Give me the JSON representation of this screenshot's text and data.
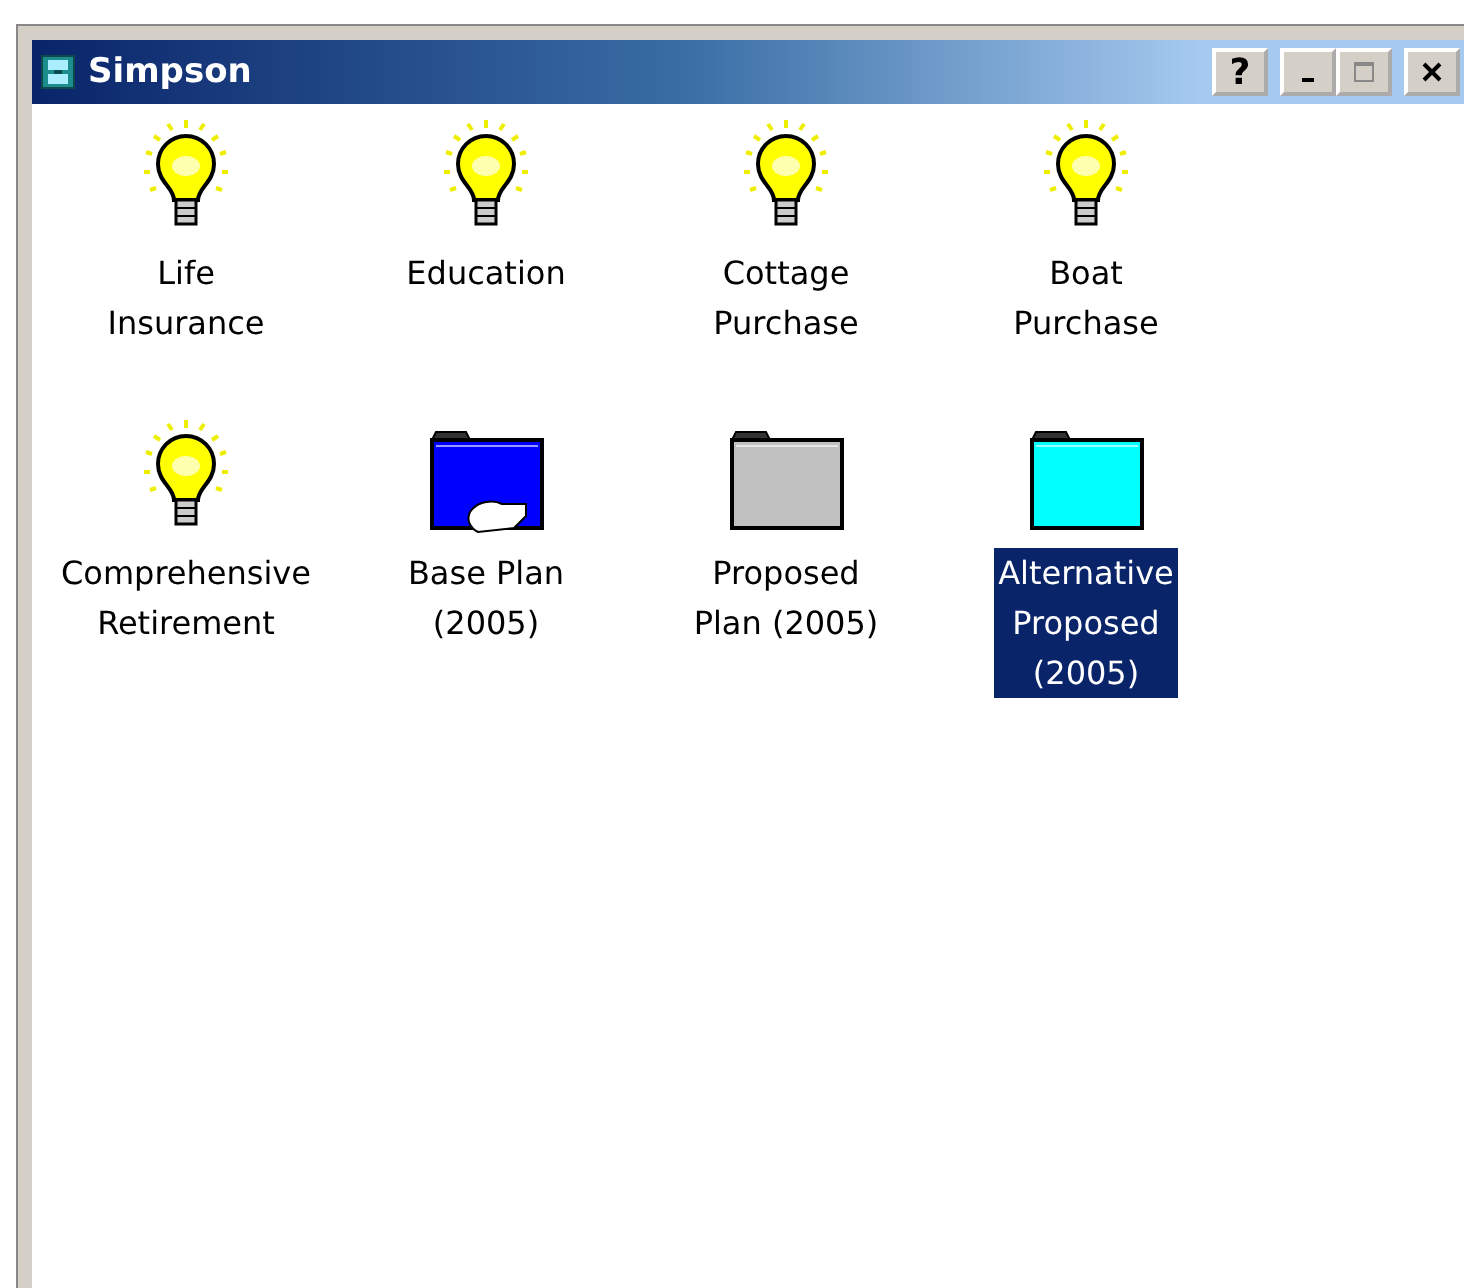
{
  "window": {
    "title": "Simpson",
    "help_button": "?"
  },
  "items": [
    {
      "kind": "idea",
      "label": "Life\nInsurance",
      "selected": false
    },
    {
      "kind": "idea",
      "label": "Education",
      "selected": false
    },
    {
      "kind": "idea",
      "label": "Cottage\nPurchase",
      "selected": false
    },
    {
      "kind": "idea",
      "label": "Boat\nPurchase",
      "selected": false
    },
    {
      "kind": "idea",
      "label": "Comprehensive\nRetirement",
      "selected": false
    },
    {
      "kind": "shared-folder",
      "label": "Base Plan\n(2005)",
      "color": "#0000ff",
      "selected": false
    },
    {
      "kind": "folder",
      "label": "Proposed\nPlan (2005)",
      "color": "#c0c0c0",
      "selected": false
    },
    {
      "kind": "folder",
      "label": "Alternative\nProposed\n(2005)",
      "color": "#00ffff",
      "selected": true
    }
  ]
}
